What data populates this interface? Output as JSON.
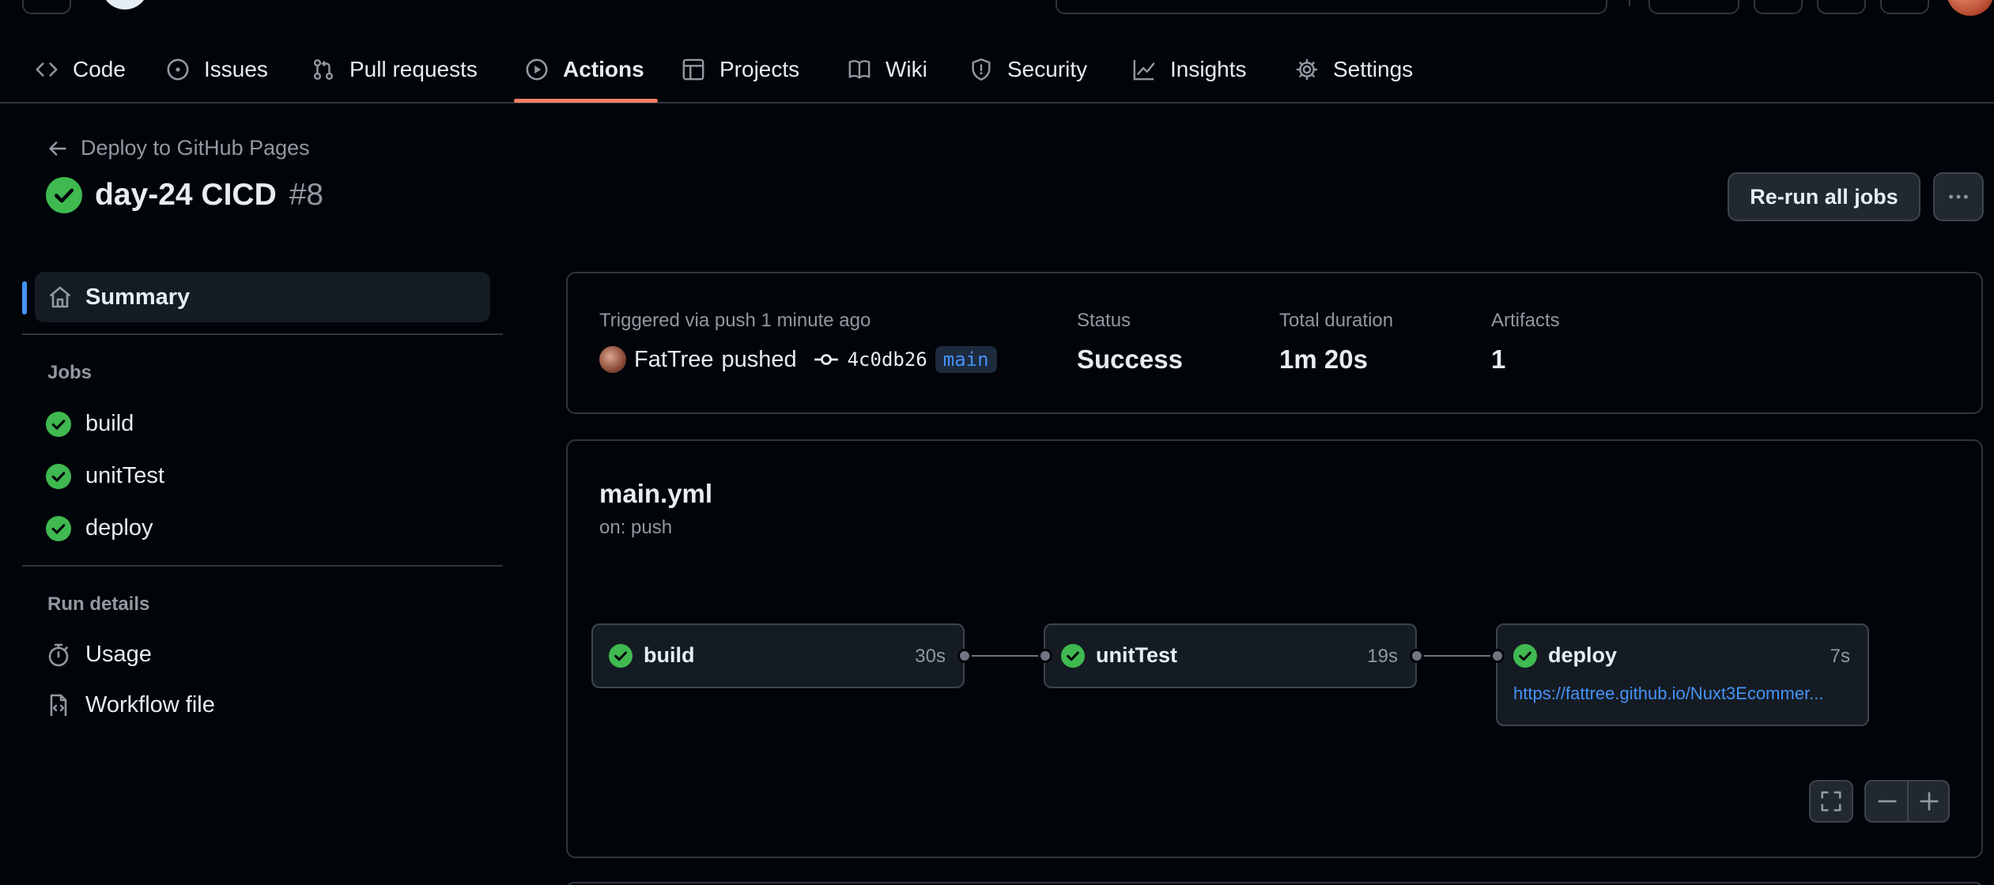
{
  "colors": {
    "success": "#3fb950",
    "accent": "#4493f8",
    "active_underline": "#f78166"
  },
  "nav": {
    "tabs": [
      {
        "label": "Code",
        "icon": "code-icon"
      },
      {
        "label": "Issues",
        "icon": "issue-opened-icon"
      },
      {
        "label": "Pull requests",
        "icon": "git-pull-request-icon"
      },
      {
        "label": "Actions",
        "icon": "play-icon",
        "active": true
      },
      {
        "label": "Projects",
        "icon": "table-icon"
      },
      {
        "label": "Wiki",
        "icon": "book-icon"
      },
      {
        "label": "Security",
        "icon": "shield-icon"
      },
      {
        "label": "Insights",
        "icon": "graph-icon"
      },
      {
        "label": "Settings",
        "icon": "gear-icon"
      }
    ]
  },
  "header": {
    "back_label": "Deploy to GitHub Pages",
    "run_name": "day-24 CICD",
    "run_number": "#8",
    "rerun_label": "Re-run all jobs"
  },
  "sidebar": {
    "summary_label": "Summary",
    "jobs_heading": "Jobs",
    "jobs": [
      {
        "label": "build",
        "status": "success"
      },
      {
        "label": "unitTest",
        "status": "success"
      },
      {
        "label": "deploy",
        "status": "success"
      }
    ],
    "run_details_heading": "Run details",
    "run_details": [
      {
        "label": "Usage",
        "icon": "stopwatch-icon"
      },
      {
        "label": "Workflow file",
        "icon": "file-code-icon"
      }
    ]
  },
  "summary": {
    "trigger_text": "Triggered via push 1 minute ago",
    "actor": "FatTree",
    "action": "pushed",
    "commit_sha": "4c0db26",
    "branch": "main",
    "status_label": "Status",
    "status_value": "Success",
    "duration_label": "Total duration",
    "duration_value": "1m 20s",
    "artifacts_label": "Artifacts",
    "artifacts_value": "1"
  },
  "workflow": {
    "file_name": "main.yml",
    "trigger": "on: push",
    "jobs": [
      {
        "name": "build",
        "duration": "30s",
        "status": "success"
      },
      {
        "name": "unitTest",
        "duration": "19s",
        "status": "success"
      },
      {
        "name": "deploy",
        "duration": "7s",
        "status": "success",
        "url": "https://fattree.github.io/Nuxt3Ecommer..."
      }
    ]
  }
}
